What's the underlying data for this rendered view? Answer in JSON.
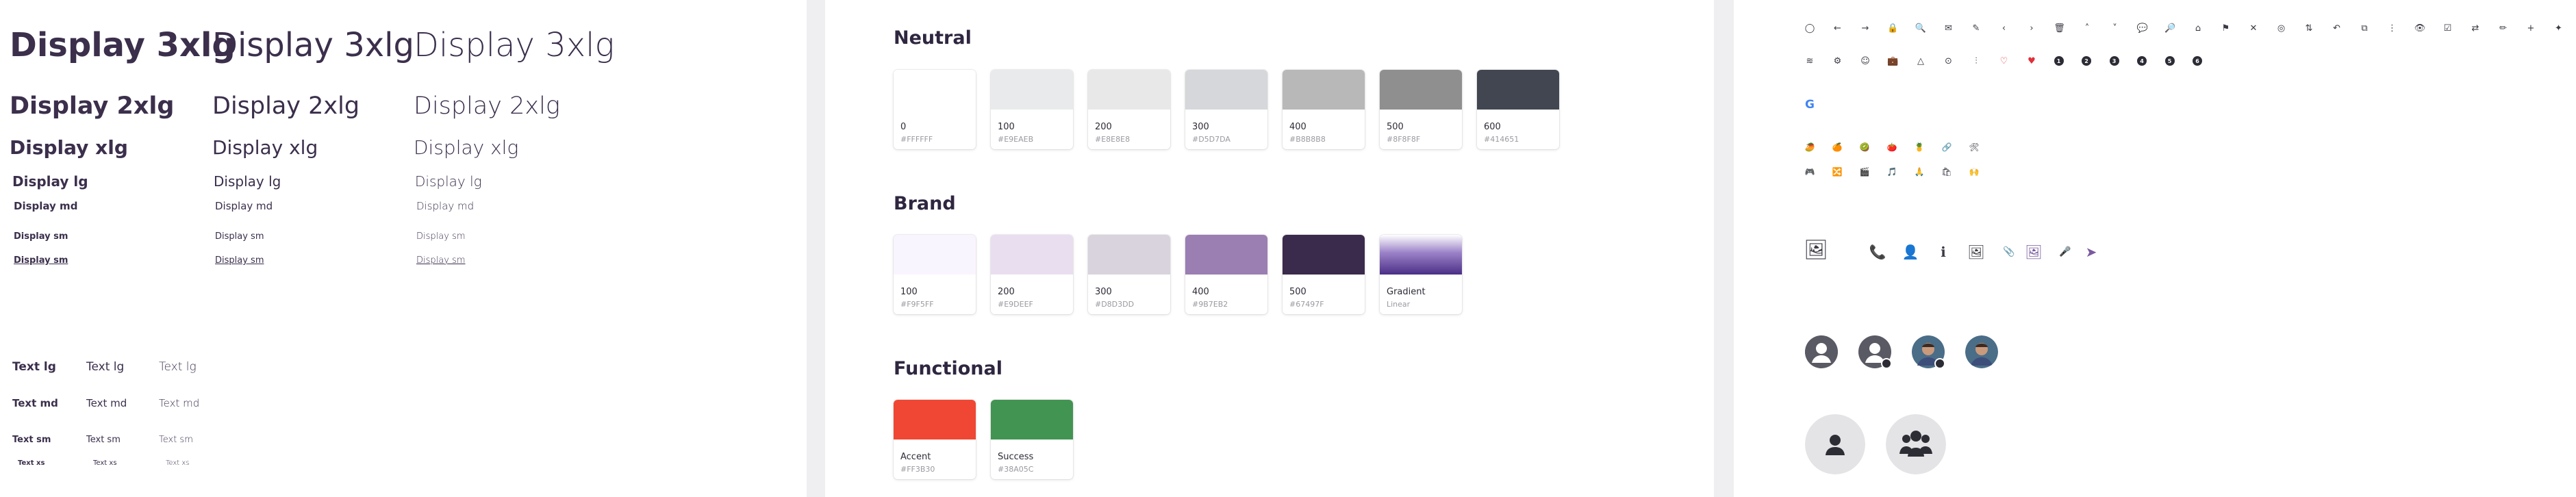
{
  "typography": {
    "display": {
      "bold": [
        "Display 3xlg",
        "Display 2xlg",
        "Display xlg",
        "Display lg",
        "Display md",
        "Display sm",
        "Display sm"
      ],
      "regular": [
        "Display 3xlg",
        "Display 2xlg",
        "Display xlg",
        "Display lg",
        "Display md",
        "Display sm",
        "Display sm"
      ],
      "light": [
        "Display 3xlg",
        "Display 2xlg",
        "Display xlg",
        "Display lg",
        "Display md",
        "Display sm",
        "Display sm"
      ]
    },
    "text": {
      "bold": [
        "Text lg",
        "Text md",
        "Text sm",
        "Text xs"
      ],
      "regular": [
        "Text lg",
        "Text md",
        "Text sm",
        "Text xs"
      ],
      "light": [
        "Text lg",
        "Text md",
        "Text sm",
        "Text xs"
      ]
    }
  },
  "colors": {
    "neutral": {
      "title": "Neutral",
      "swatches": [
        {
          "name": "0",
          "hex": "#FFFFFF",
          "color": "#FFFFFF"
        },
        {
          "name": "100",
          "hex": "#E9EAEB",
          "color": "#E9EAEB"
        },
        {
          "name": "200",
          "hex": "#E8E8E8",
          "color": "#E8E8E8"
        },
        {
          "name": "300",
          "hex": "#D5D7DA",
          "color": "#D5D7DA"
        },
        {
          "name": "400",
          "hex": "#B8B8B8",
          "color": "#B8B8B8"
        },
        {
          "name": "500",
          "hex": "#8F8F8F",
          "color": "#8F8F8F"
        },
        {
          "name": "600",
          "hex": "#414651",
          "color": "#414651"
        }
      ]
    },
    "brand": {
      "title": "Brand",
      "swatches": [
        {
          "name": "100",
          "hex": "#F9F5FF",
          "color": "#F9F5FF"
        },
        {
          "name": "200",
          "hex": "#E9DEEF",
          "color": "#E9DEEF"
        },
        {
          "name": "300",
          "hex": "#D8D3DD",
          "color": "#D8D3DD"
        },
        {
          "name": "400",
          "hex": "#9B7EB2",
          "color": "#9B7EB2"
        },
        {
          "name": "500",
          "hex": "#67497F",
          "color": "#3A2A4C"
        },
        {
          "name": "Gradient",
          "hex": "Linear",
          "color": "gradient"
        }
      ]
    },
    "functional": {
      "title": "Functional",
      "swatches": [
        {
          "name": "Accent",
          "hex": "#FF3B30",
          "color": "#EF4733"
        },
        {
          "name": "Success",
          "hex": "#38A05C",
          "color": "#429452"
        }
      ]
    }
  },
  "icons": {
    "row1": [
      "circle-icon",
      "arrow-left-icon",
      "arrow-right-icon",
      "lock-icon",
      "search-icon",
      "mail-icon",
      "edit-icon",
      "chevron-left-icon",
      "chevron-right-icon",
      "trash-icon",
      "chevron-up-icon",
      "chevron-down-icon",
      "chat-icon",
      "chat-search-icon",
      "home-icon",
      "flag-icon",
      "close-icon",
      "target-icon",
      "sort-icon",
      "undo-icon",
      "copy-icon",
      "more-vertical-icon",
      "eye-icon",
      "checkbox-icon",
      "swap-icon",
      "pencil-icon",
      "plus-icon",
      "sparkle-icon"
    ],
    "row1_glyphs": [
      "◯",
      "←",
      "→",
      "🔒",
      "🔍",
      "✉",
      "✎",
      "‹",
      "›",
      "🗑",
      "˄",
      "˅",
      "💬",
      "🔎",
      "⌂",
      "⚑",
      "✕",
      "◎",
      "⇅",
      "↶",
      "⧉",
      "⋮",
      "👁",
      "☑",
      "⇄",
      "✏",
      "+",
      "✦"
    ],
    "row2": [
      "layers-icon",
      "sliders-icon",
      "face-icon",
      "briefcase-icon",
      "shape-icon",
      "location-icon",
      "chart-icon",
      "heart-outline-icon",
      "heart-filled-icon"
    ],
    "row2_glyphs": [
      "≋",
      "⚙",
      "☺",
      "💼",
      "△",
      "⊙",
      "⫶",
      "♡",
      "♥"
    ],
    "number_badges": [
      "1",
      "2",
      "3",
      "4",
      "5",
      "6"
    ],
    "brand_icon_glyph": "G",
    "emoji_row1": [
      "🥭",
      "🍊",
      "🥝",
      "🍅",
      "🍍",
      "🔗",
      "🛠"
    ],
    "emoji_row2": [
      "🎮",
      "🔀",
      "🎬",
      "🎵",
      "🙏",
      "🛍",
      "🙌"
    ],
    "large_icons_glyphs": [
      "🖼",
      "📞",
      "👤",
      "ℹ",
      "🖼",
      "📎",
      "🖼",
      "🎤",
      "➤"
    ],
    "large_icons": [
      "add-photo-icon",
      "phone-icon",
      "account-icon",
      "info-icon",
      "image-icon",
      "attach-icon",
      "image-filled-icon",
      "mic-icon",
      "send-icon"
    ],
    "accent": "#7a5aa0"
  }
}
